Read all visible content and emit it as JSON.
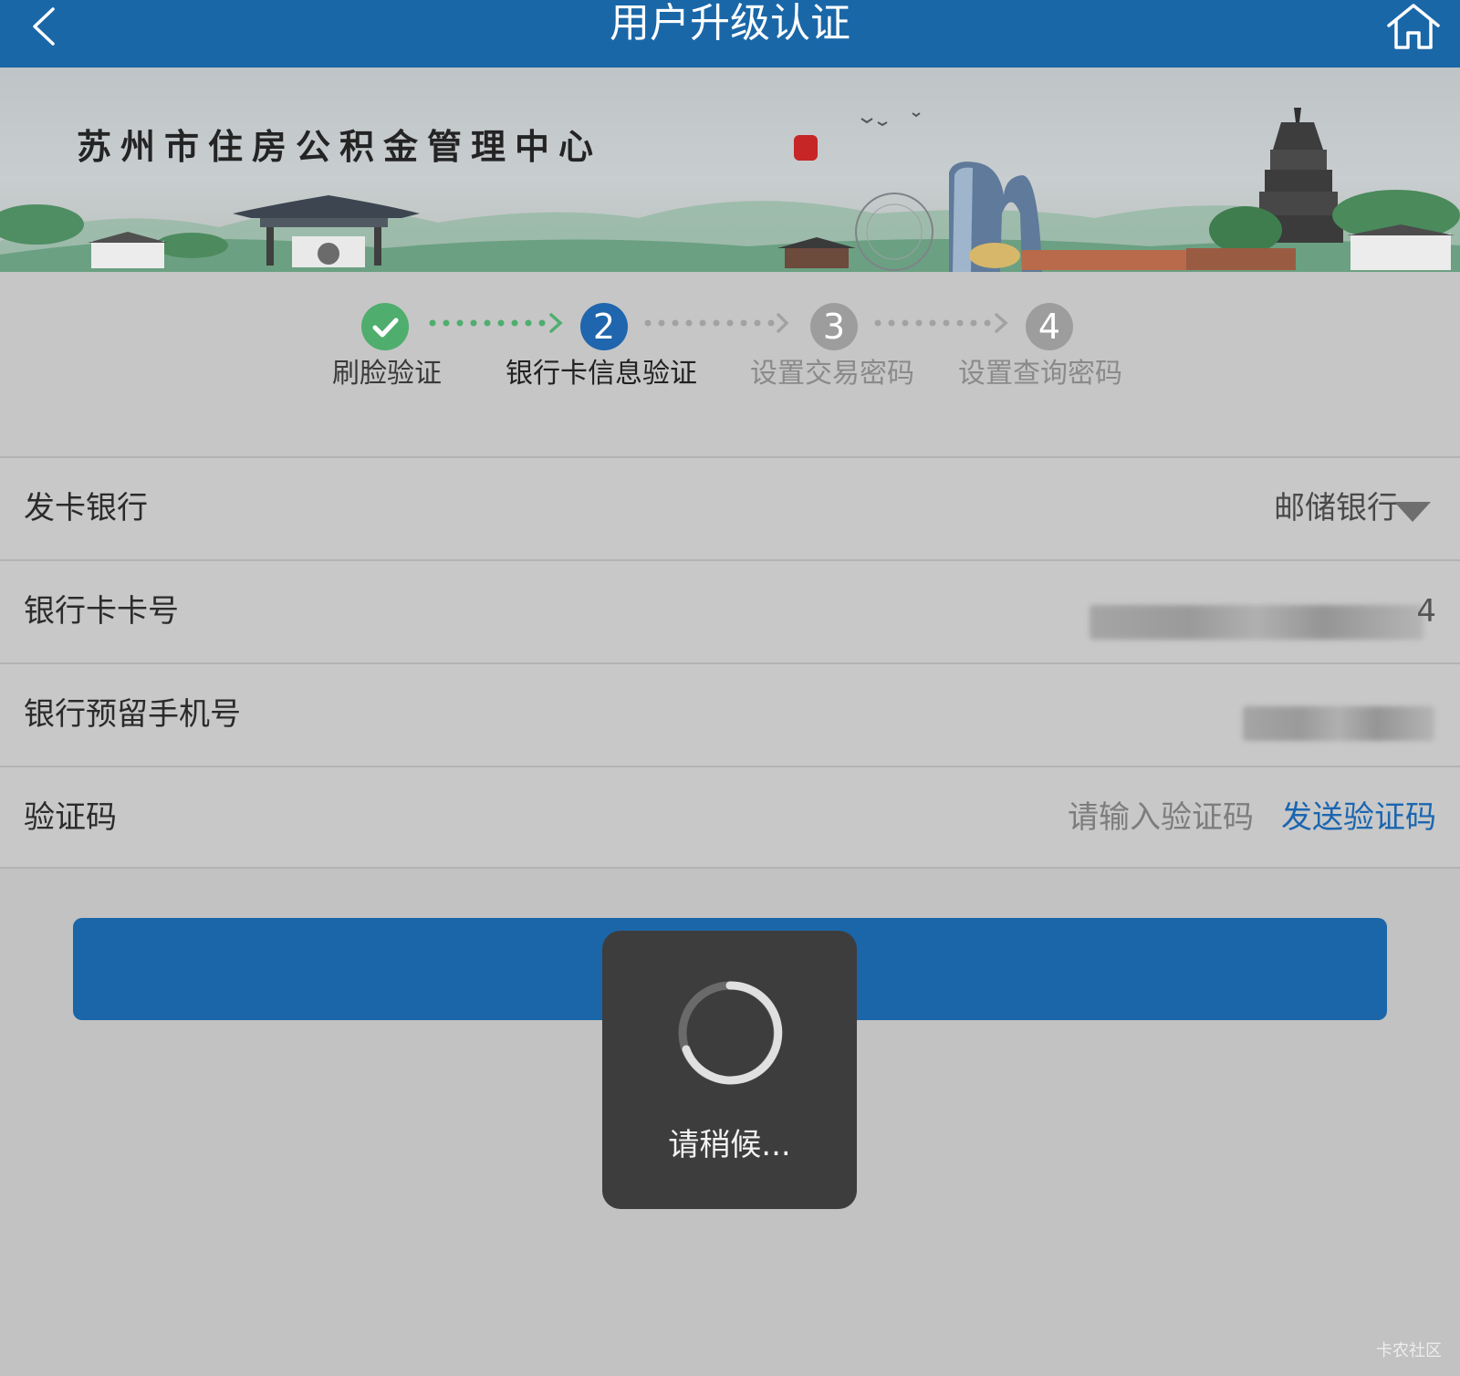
{
  "header": {
    "title": "用户升级认证",
    "back_icon": "back-chevron-icon",
    "home_icon": "home-icon"
  },
  "banner": {
    "title": "苏州市住房公积金管理中心"
  },
  "steps": [
    {
      "label": "刷脸验证",
      "number": "",
      "state": "done"
    },
    {
      "label": "银行卡信息验证",
      "number": "2",
      "state": "active"
    },
    {
      "label": "设置交易密码",
      "number": "3",
      "state": "pending"
    },
    {
      "label": "设置查询密码",
      "number": "4",
      "state": "pending"
    }
  ],
  "form": {
    "bank": {
      "label": "发卡银行",
      "value": "邮储银行"
    },
    "card_number": {
      "label": "银行卡卡号",
      "value_suffix": "4"
    },
    "phone": {
      "label": "银行预留手机号"
    },
    "code": {
      "label": "验证码",
      "placeholder": "请输入验证码",
      "send_label": "发送验证码"
    }
  },
  "loading": {
    "text": "请稍候..."
  },
  "watermark": "卡农社区",
  "colors": {
    "header_bg": "#1a67a8",
    "done_green": "#4fae6e",
    "active_blue": "#1f66ae",
    "pending_gray": "#9d9d9d",
    "link_blue": "#1b66b0",
    "overlay_dark": "#3d3d3d"
  }
}
